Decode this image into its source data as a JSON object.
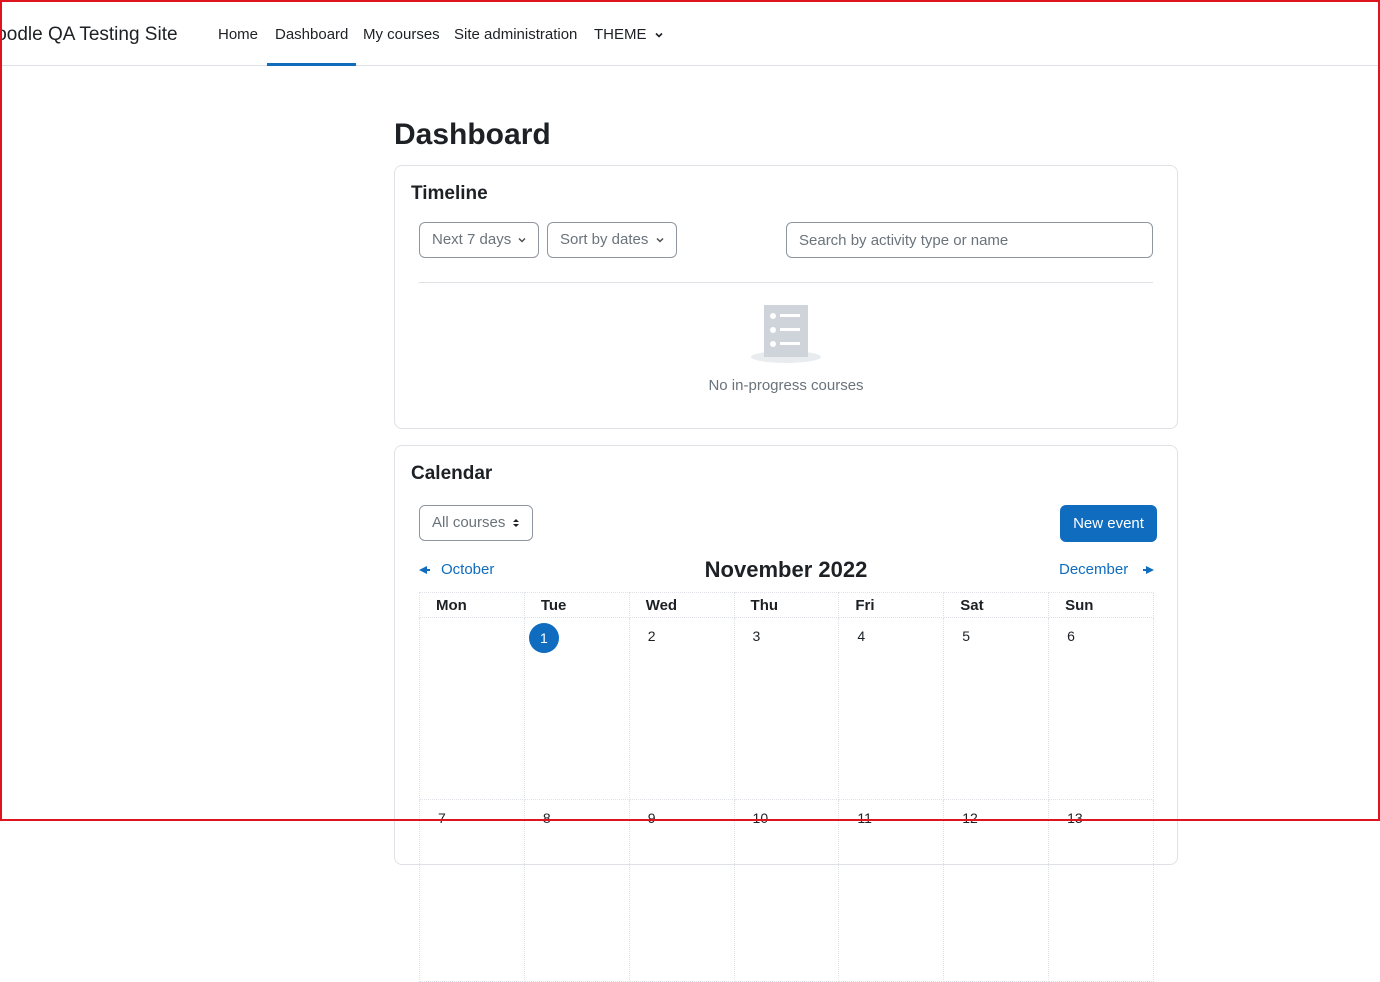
{
  "navbar": {
    "brand": "loodle QA Testing Site",
    "items": [
      {
        "label": "Home"
      },
      {
        "label": "Dashboard"
      },
      {
        "label": "My courses"
      },
      {
        "label": "Site administration"
      },
      {
        "label": "THEME"
      }
    ]
  },
  "page": {
    "title": "Dashboard"
  },
  "timeline": {
    "title": "Timeline",
    "range_select": "Next 7 days",
    "sort_select": "Sort by dates",
    "search_placeholder": "Search by activity type or name",
    "empty_text": "No in-progress courses"
  },
  "calendar": {
    "title": "Calendar",
    "course_filter": "All courses",
    "new_event_label": "New event",
    "prev_month": "October",
    "next_month": "December",
    "month_title": "November 2022",
    "weekdays": [
      "Mon",
      "Tue",
      "Wed",
      "Thu",
      "Fri",
      "Sat",
      "Sun"
    ],
    "week1": [
      "",
      "1",
      "2",
      "3",
      "4",
      "5",
      "6"
    ],
    "week2": [
      "7",
      "8",
      "9",
      "10",
      "11",
      "12",
      "13"
    ],
    "today": "1"
  },
  "colors": {
    "accent": "#0f6cbf",
    "frame": "#e0141e"
  }
}
